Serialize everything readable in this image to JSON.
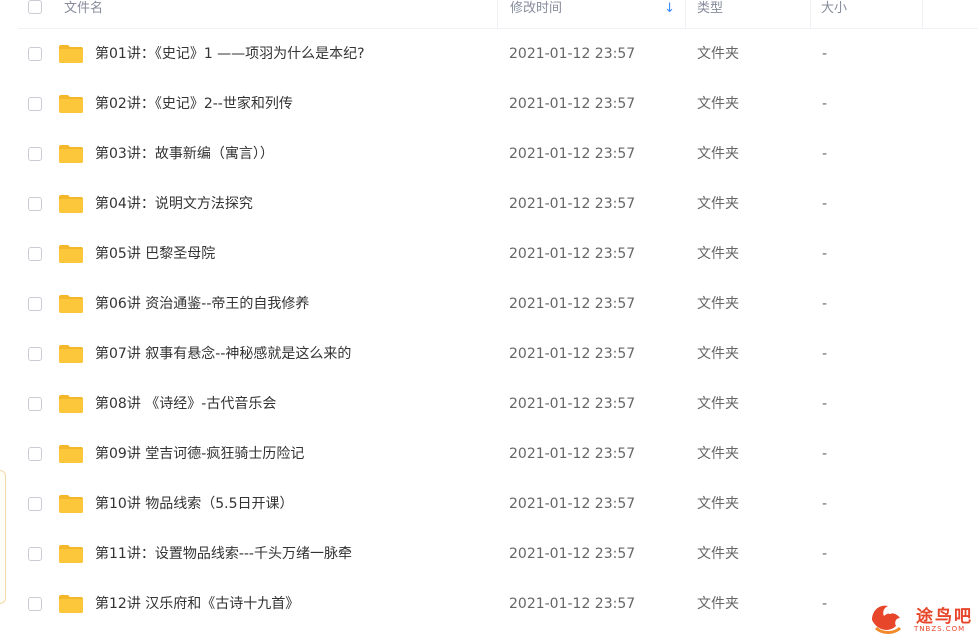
{
  "header": {
    "name_label": "文件名",
    "time_label": "修改时间",
    "type_label": "类型",
    "size_label": "大小",
    "sort_icon": "sort-descending-arrow-icon"
  },
  "colors": {
    "accent": "#3b8cff",
    "folder": "#fcc73b",
    "folder_dark": "#f5b72a",
    "text": "#333333",
    "muted": "#878c9c",
    "watermark": "#e8462a"
  },
  "rows": [
    {
      "name": "第01讲：《史记》1 ——项羽为什么是本纪?",
      "time": "2021-01-12 23:57",
      "type": "文件夹",
      "size": "-"
    },
    {
      "name": "第02讲：《史记》2--世家和列传",
      "time": "2021-01-12 23:57",
      "type": "文件夹",
      "size": "-"
    },
    {
      "name": "第03讲：故事新编（寓言））",
      "time": "2021-01-12 23:57",
      "type": "文件夹",
      "size": "-"
    },
    {
      "name": "第04讲：说明文方法探究",
      "time": "2021-01-12 23:57",
      "type": "文件夹",
      "size": "-"
    },
    {
      "name": "第05讲 巴黎圣母院",
      "time": "2021-01-12 23:57",
      "type": "文件夹",
      "size": "-"
    },
    {
      "name": "第06讲 资治通鉴--帝王的自我修养",
      "time": "2021-01-12 23:57",
      "type": "文件夹",
      "size": "-"
    },
    {
      "name": "第07讲 叙事有悬念--神秘感就是这么来的",
      "time": "2021-01-12 23:57",
      "type": "文件夹",
      "size": "-"
    },
    {
      "name": "第08讲 《诗经》-古代音乐会",
      "time": "2021-01-12 23:57",
      "type": "文件夹",
      "size": "-"
    },
    {
      "name": "第09讲 堂吉诃德-疯狂骑士历险记",
      "time": "2021-01-12 23:57",
      "type": "文件夹",
      "size": "-"
    },
    {
      "name": "第10讲 物品线索（5.5日开课）",
      "time": "2021-01-12 23:57",
      "type": "文件夹",
      "size": "-"
    },
    {
      "name": "第11讲：设置物品线索---千头万绪一脉牵",
      "time": "2021-01-12 23:57",
      "type": "文件夹",
      "size": "-"
    },
    {
      "name": "第12讲 汉乐府和《古诗十九首》",
      "time": "2021-01-12 23:57",
      "type": "文件夹",
      "size": "-"
    }
  ],
  "watermark": {
    "title": "途鸟吧",
    "subtitle": "TNBZS.COM",
    "icon": "bird-logo-icon"
  }
}
